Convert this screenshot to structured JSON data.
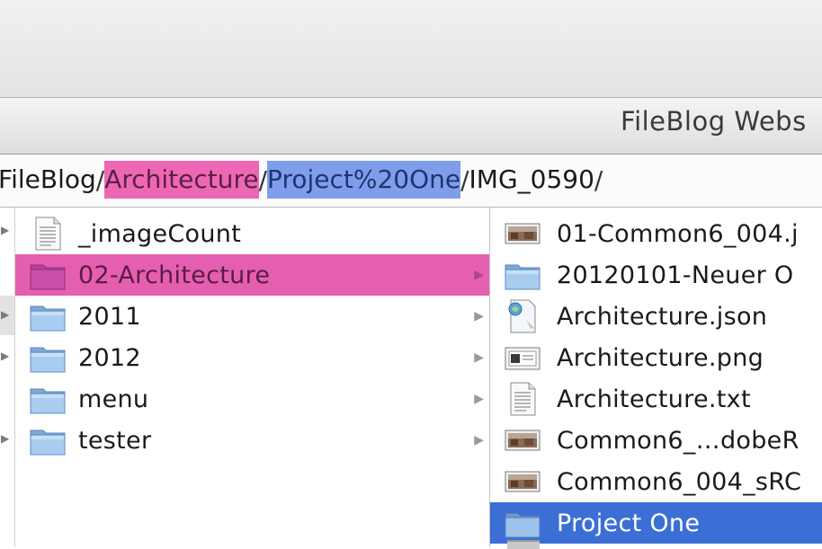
{
  "window": {
    "title": "FileBlog Webs"
  },
  "path": {
    "segments": [
      {
        "label": "FileBlog"
      },
      {
        "label": "Architecture"
      },
      {
        "label": "Project%20One"
      },
      {
        "label": "IMG_0590"
      }
    ],
    "separator": "/"
  },
  "column2": {
    "items": [
      {
        "label": "_imageCount",
        "icon": "text-document-icon"
      },
      {
        "label": "02-Architecture",
        "icon": "folder-icon",
        "selected": true
      },
      {
        "label": "2011",
        "icon": "folder-icon"
      },
      {
        "label": "2012",
        "icon": "folder-icon"
      },
      {
        "label": "menu",
        "icon": "folder-icon"
      },
      {
        "label": "tester",
        "icon": "folder-icon"
      }
    ],
    "arrow_glyph": "▶"
  },
  "column3": {
    "items": [
      {
        "label": "01-Common6_004.j",
        "icon": "image-file-icon"
      },
      {
        "label": "20120101-Neuer O",
        "icon": "folder-icon"
      },
      {
        "label": "Architecture.json",
        "icon": "json-file-icon"
      },
      {
        "label": "Architecture.png",
        "icon": "png-file-icon"
      },
      {
        "label": "Architecture.txt",
        "icon": "text-document-icon"
      },
      {
        "label": "Common6_…dobeR",
        "icon": "image-file-icon"
      },
      {
        "label": "Common6_004_sRC",
        "icon": "image-file-icon"
      },
      {
        "label": "Project One",
        "icon": "folder-icon",
        "selected": true
      }
    ]
  },
  "colors": {
    "pink_highlight": "#e55fb0",
    "blue_highlight": "#3c6fd6",
    "path_pink": "#ee67b4",
    "path_blue": "#7e9eeb",
    "folder_blue": "#8fbbe6"
  }
}
